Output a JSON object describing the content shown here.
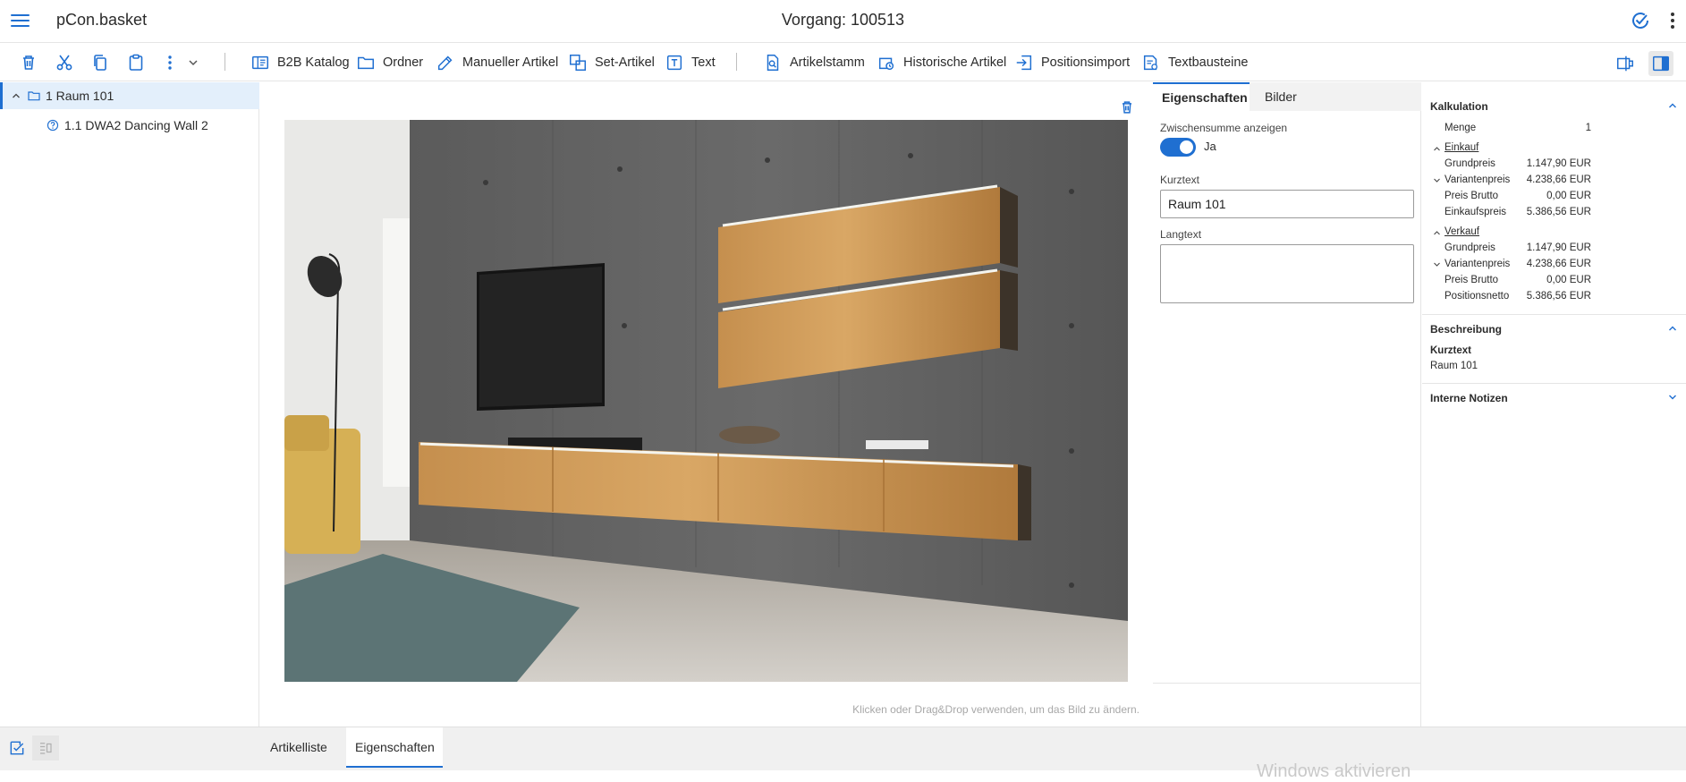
{
  "header": {
    "app_title": "pCon.basket",
    "document_title": "Vorgang: 100513"
  },
  "toolbar": {
    "items": [
      {
        "label": "B2B Katalog",
        "icon": "catalog-icon"
      },
      {
        "label": "Ordner",
        "icon": "folder-icon"
      },
      {
        "label": "Manueller Artikel",
        "icon": "edit-icon"
      },
      {
        "label": "Set-Artikel",
        "icon": "set-icon"
      },
      {
        "label": "Text",
        "icon": "text-icon"
      },
      {
        "label": "Artikelstamm",
        "icon": "search-doc-icon"
      },
      {
        "label": "Historische Artikel",
        "icon": "history-icon"
      },
      {
        "label": "Positionsimport",
        "icon": "import-icon"
      },
      {
        "label": "Textbausteine",
        "icon": "text-blocks-icon"
      }
    ]
  },
  "tree": {
    "items": [
      {
        "label": "1 Raum 101",
        "type": "folder",
        "expanded": true,
        "selected": true
      },
      {
        "label": "1.1 DWA2 Dancing Wall 2",
        "type": "unknown-article",
        "selected": false
      }
    ]
  },
  "center": {
    "image_hint": "Klicken oder Drag&Drop verwenden, um das Bild zu ändern."
  },
  "properties": {
    "tabs": [
      {
        "label": "Eigenschaften",
        "active": true
      },
      {
        "label": "Bilder",
        "active": false
      }
    ],
    "subtotal_label": "Zwischensumme anzeigen",
    "subtotal_value": "Ja",
    "subtotal_on": true,
    "kurztext_label": "Kurztext",
    "kurztext_value": "Raum 101",
    "langtext_label": "Langtext",
    "langtext_value": ""
  },
  "calculation": {
    "title": "Kalkulation",
    "menge_label": "Menge",
    "menge_value": "1",
    "einkauf": {
      "title": "Einkauf",
      "rows": [
        {
          "label": "Grundpreis",
          "value": "1.147,90 EUR"
        },
        {
          "label": "Variantenpreis",
          "value": "4.238,66 EUR"
        },
        {
          "label": "Preis Brutto",
          "value": "0,00 EUR"
        },
        {
          "label": "Einkaufspreis",
          "value": "5.386,56 EUR"
        }
      ]
    },
    "verkauf": {
      "title": "Verkauf",
      "rows": [
        {
          "label": "Grundpreis",
          "value": "1.147,90 EUR"
        },
        {
          "label": "Variantenpreis",
          "value": "4.238,66 EUR"
        },
        {
          "label": "Preis Brutto",
          "value": "0,00 EUR"
        },
        {
          "label": "Positionsnetto",
          "value": "5.386,56 EUR"
        }
      ]
    },
    "description": {
      "title": "Beschreibung",
      "key": "Kurztext",
      "value": "Raum 101"
    },
    "notes": {
      "title": "Interne Notizen"
    }
  },
  "bottom": {
    "tabs": [
      {
        "label": "Artikelliste",
        "active": false
      },
      {
        "label": "Eigenschaften",
        "active": true
      }
    ],
    "watermark": "Windows aktivieren"
  },
  "colors": {
    "accent": "#1f6fd1",
    "selection": "#e3effb"
  }
}
